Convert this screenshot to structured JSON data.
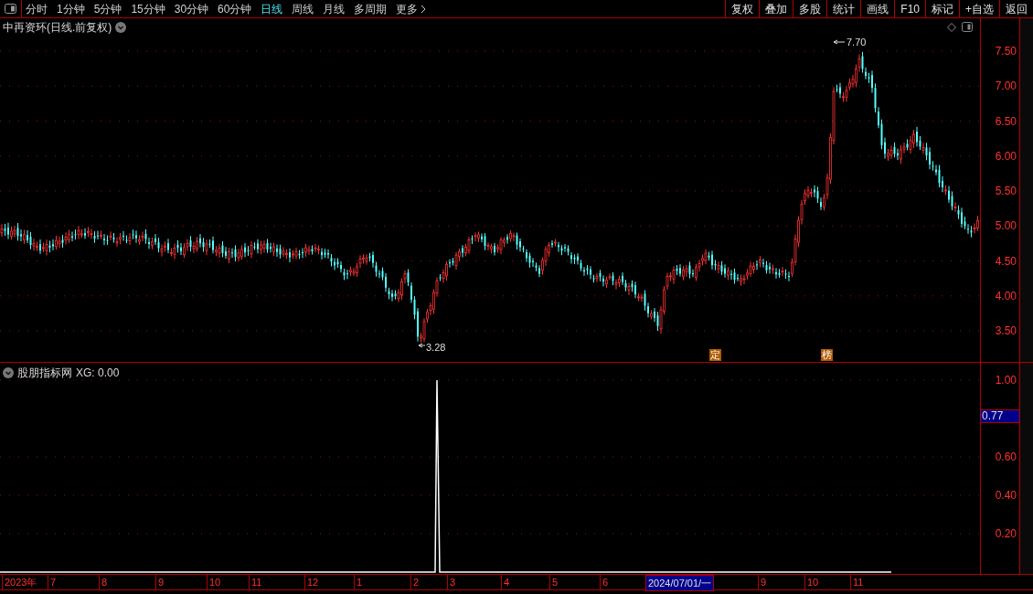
{
  "toolbar": {
    "periods": [
      {
        "label": "分时",
        "selected": false
      },
      {
        "label": "1分钟",
        "selected": false
      },
      {
        "label": "5分钟",
        "selected": false
      },
      {
        "label": "15分钟",
        "selected": false
      },
      {
        "label": "30分钟",
        "selected": false
      },
      {
        "label": "60分钟",
        "selected": false
      },
      {
        "label": "日线",
        "selected": true
      },
      {
        "label": "周线",
        "selected": false
      },
      {
        "label": "月线",
        "selected": false
      },
      {
        "label": "多周期",
        "selected": false
      },
      {
        "label": "更多",
        "selected": false
      }
    ],
    "buttons": [
      "复权",
      "叠加",
      "多股",
      "统计",
      "画线",
      "F10",
      "标记",
      "+自选",
      "返回"
    ]
  },
  "price_chart": {
    "title": "中再资环(日线.前复权)",
    "y_ticks": [
      "7.50",
      "7.00",
      "6.50",
      "6.00",
      "5.50",
      "5.00",
      "4.50",
      "4.00",
      "3.50"
    ],
    "high_label": "7.70",
    "low_label": "3.28",
    "event_badges": [
      "定",
      "榜"
    ]
  },
  "indicator_panel": {
    "title": "股朋指标网",
    "reading": "XG: 0.00",
    "y_ticks": [
      "1.00",
      "0.60",
      "0.40",
      "0.20"
    ],
    "cursor_value": "0.77"
  },
  "time_axis": [
    {
      "label": "2023年",
      "highlighted": false
    },
    {
      "label": "7",
      "highlighted": false
    },
    {
      "label": "8",
      "highlighted": false
    },
    {
      "label": "9",
      "highlighted": false
    },
    {
      "label": "10",
      "highlighted": false
    },
    {
      "label": "11",
      "highlighted": false
    },
    {
      "label": "12",
      "highlighted": false
    },
    {
      "label": "1",
      "highlighted": false
    },
    {
      "label": "2",
      "highlighted": false
    },
    {
      "label": "3",
      "highlighted": false
    },
    {
      "label": "4",
      "highlighted": false
    },
    {
      "label": "5",
      "highlighted": false
    },
    {
      "label": "6",
      "highlighted": false
    },
    {
      "label": "2024/07/01/一",
      "highlighted": true
    },
    {
      "label": "9",
      "highlighted": false
    },
    {
      "label": "10",
      "highlighted": false
    },
    {
      "label": "11",
      "highlighted": false
    }
  ]
}
